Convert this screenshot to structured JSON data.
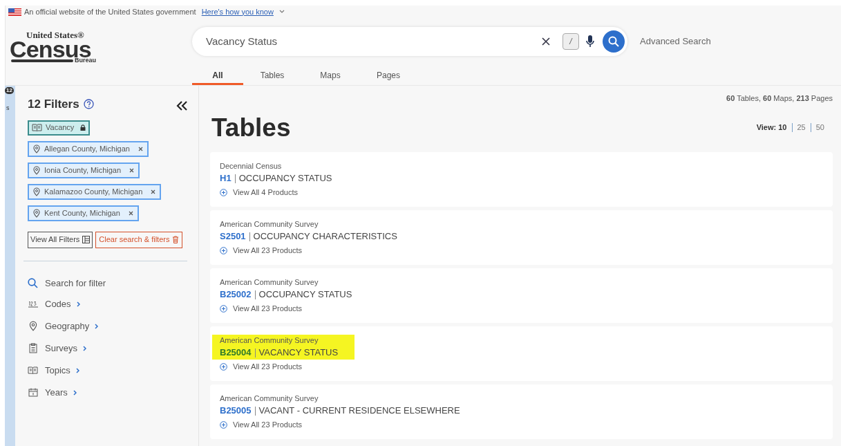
{
  "gov_banner": {
    "text": "An official website of the United States government",
    "link": "Here's how you know"
  },
  "logo": {
    "line_1": "United States®",
    "line_2": "Census",
    "line_3": "Bureau"
  },
  "search": {
    "value": "Vacancy Status",
    "shortcut": "/",
    "advanced": "Advanced Search"
  },
  "tabs": [
    {
      "label": "All",
      "selected": true
    },
    {
      "label": "Tables",
      "selected": false
    },
    {
      "label": "Maps",
      "selected": false
    },
    {
      "label": "Pages",
      "selected": false
    }
  ],
  "side_tab": {
    "badge": "12",
    "label": "s"
  },
  "filters": {
    "title": "12 Filters",
    "chips": [
      {
        "label": "Vacancy",
        "kind": "topic"
      },
      {
        "label": "Allegan County, Michigan",
        "kind": "geography"
      },
      {
        "label": "Ionia County, Michigan",
        "kind": "geography"
      },
      {
        "label": "Kalamazoo County, Michigan",
        "kind": "geography"
      },
      {
        "label": "Kent County, Michigan",
        "kind": "geography"
      }
    ],
    "view_all": "View All Filters",
    "clear": "Clear search & filters",
    "search_placeholder": "Search for filter",
    "categories": [
      {
        "label": "Codes",
        "kind": "codes"
      },
      {
        "label": "Geography",
        "kind": "geography"
      },
      {
        "label": "Surveys",
        "kind": "surveys"
      },
      {
        "label": "Topics",
        "kind": "topics"
      },
      {
        "label": "Years",
        "kind": "years"
      }
    ]
  },
  "summary": "**60** Tables,  **60** Maps,  **213** Pages",
  "heading": "Tables",
  "view": {
    "label": "View: ",
    "options": [
      {
        "label": "10",
        "selected": true
      },
      {
        "label": "25",
        "selected": false
      },
      {
        "label": "50",
        "selected": false
      }
    ]
  },
  "results": [
    {
      "source": "Decennial Census",
      "code": "H1",
      "title": "OCCUPANCY STATUS",
      "products": "View All 4 Products",
      "highlighted": false
    },
    {
      "source": "American Community Survey",
      "code": "S2501",
      "title": "OCCUPANCY CHARACTERISTICS",
      "products": "View All 23 Products",
      "highlighted": false
    },
    {
      "source": "American Community Survey",
      "code": "B25002",
      "title": "OCCUPANCY STATUS",
      "products": "View All 23 Products",
      "highlighted": false
    },
    {
      "source": "American Community Survey",
      "code": "B25004",
      "title": "VACANCY STATUS",
      "products": "View All 23 Products",
      "highlighted": true
    },
    {
      "source": "American Community Survey",
      "code": "B25005",
      "title": "VACANT - CURRENT RESIDENCE ELSEWHERE",
      "products": "View All 23 Products",
      "highlighted": false
    }
  ]
}
